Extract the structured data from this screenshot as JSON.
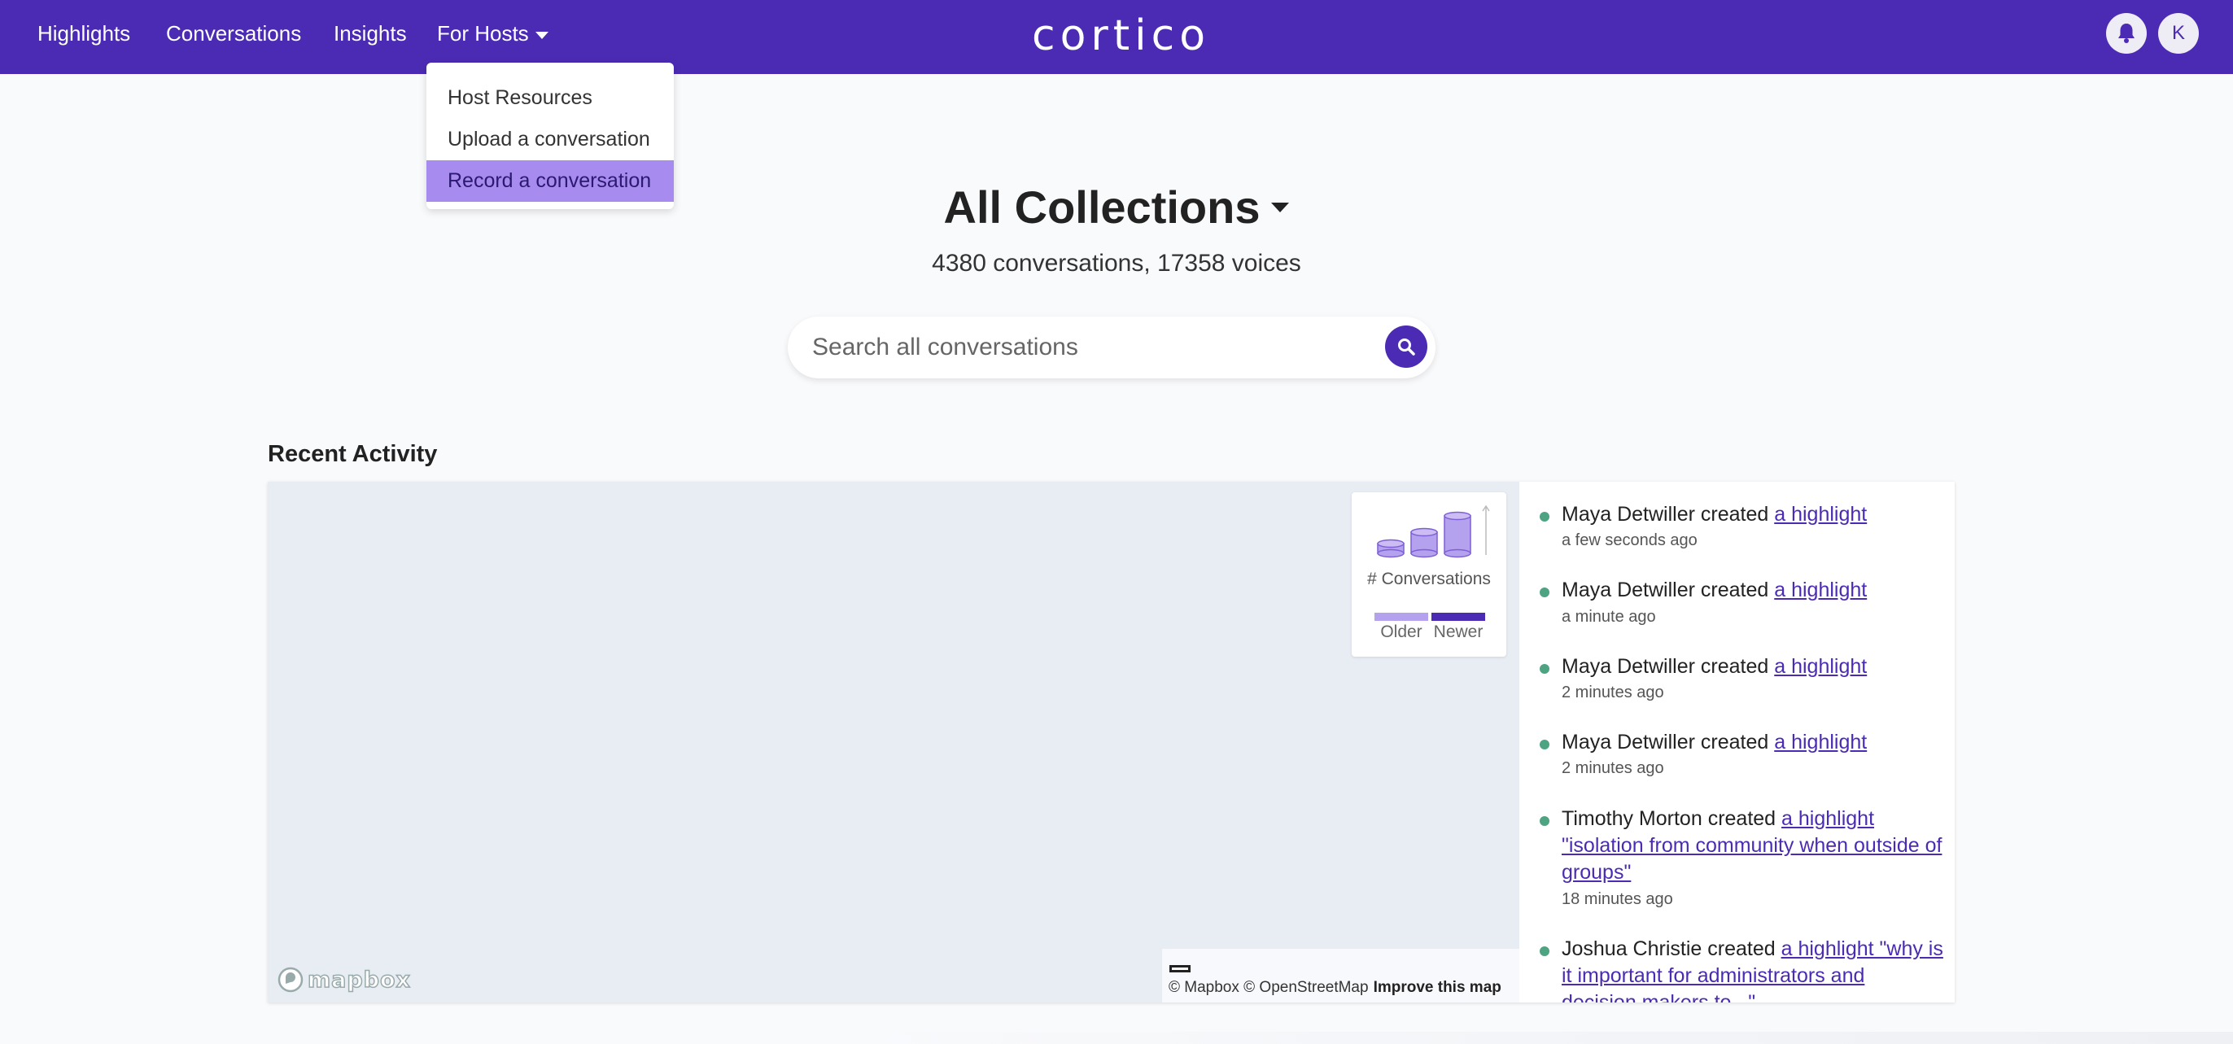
{
  "nav": {
    "items": [
      "Highlights",
      "Conversations",
      "Insights",
      "For Hosts"
    ],
    "logo": "cortico",
    "avatar_initial": "K",
    "bell_icon": "bell-icon",
    "brand_color": "#4b2bb3"
  },
  "dropdown": {
    "items": [
      "Host Resources",
      "Upload a conversation",
      "Record a conversation"
    ],
    "active_index": 2
  },
  "header": {
    "title": "All Collections",
    "subtitle": "4380 conversations, 17358 voices"
  },
  "search": {
    "placeholder": "Search all conversations",
    "icon": "search-icon"
  },
  "recent_activity": {
    "title": "Recent Activity",
    "legend": {
      "label": "# Conversations",
      "older": "Older",
      "newer": "Newer"
    },
    "map_attribution": {
      "logo": "mapbox",
      "text": "© Mapbox © OpenStreetMap",
      "improve": "Improve this map"
    },
    "feed": [
      {
        "user": "Maya Detwiller",
        "verb": "created",
        "link": "a highlight",
        "time": "a few seconds ago"
      },
      {
        "user": "Maya Detwiller",
        "verb": "created",
        "link": "a highlight",
        "time": "a minute ago"
      },
      {
        "user": "Maya Detwiller",
        "verb": "created",
        "link": "a highlight",
        "time": "2 minutes ago"
      },
      {
        "user": "Maya Detwiller",
        "verb": "created",
        "link": "a highlight",
        "time": "2 minutes ago"
      },
      {
        "user": "Timothy Morton",
        "verb": "created",
        "link": "a highlight \"isolation from community when outside of groups\"",
        "time": "18 minutes ago"
      },
      {
        "user": "Joshua Christie",
        "verb": "created",
        "link": "a highlight \"why is it important for administrators and decision makers to...\"",
        "time": ""
      }
    ]
  }
}
